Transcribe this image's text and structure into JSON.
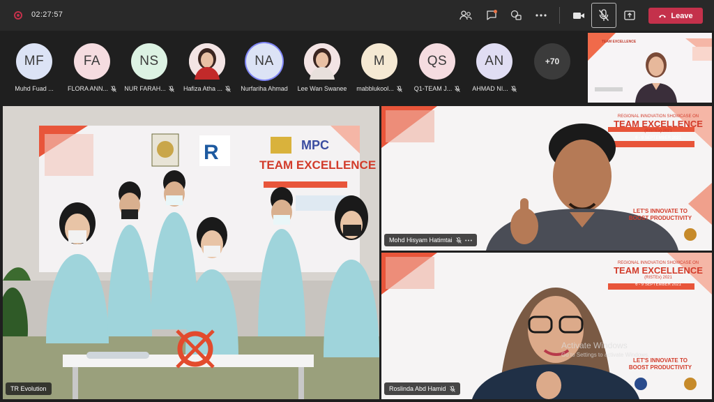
{
  "topbar": {
    "timer": "02:27:57",
    "leave_label": "Leave",
    "icons": [
      "record-icon",
      "participants-icon",
      "chat-icon",
      "reactions-icon",
      "more-options-icon",
      "camera-icon",
      "mic-off-icon",
      "share-icon",
      "phone-icon"
    ]
  },
  "participants": [
    {
      "initials": "MF",
      "name": "Muhd Fuad ...",
      "color": "#dce3f5",
      "muted": false
    },
    {
      "initials": "FA",
      "name": "FLORA ANN...",
      "color": "#f5dce0",
      "muted": true
    },
    {
      "initials": "NS",
      "name": "NUR FARAH...",
      "color": "#dcf2e3",
      "muted": true
    },
    {
      "initials": "",
      "name": "Hafiza Atha ...",
      "color": "#e7d9d9",
      "muted": true,
      "photo": true
    },
    {
      "initials": "NA",
      "name": "Nurfariha Ahmad",
      "color": "#dce3f5",
      "muted": false,
      "speaking": true
    },
    {
      "initials": "",
      "name": "Lee Wan Swanee",
      "color": "#e9d8cf",
      "muted": false,
      "photo": true
    },
    {
      "initials": "M",
      "name": "mabblukool...",
      "color": "#f5e9d3",
      "muted": true
    },
    {
      "initials": "QS",
      "name": "Q1-TEAM J...",
      "color": "#f5dce0",
      "muted": true
    },
    {
      "initials": "AN",
      "name": "AHMAD NI...",
      "color": "#e0ddf3",
      "muted": true
    }
  ],
  "more_count": "+70",
  "tiles": {
    "main": {
      "name": "TR Evolution"
    },
    "hisyam": {
      "name": "Mohd Hisyam Hatimtai"
    },
    "roslinda": {
      "name": "Roslinda Abd Hamid"
    }
  },
  "banner": {
    "line1": "REGIONAL INNOVATION SHOWCASE ON",
    "line2": "TEAM EXCELLENCE",
    "line3": "(RISTEx) 2021",
    "dates": "6 - 9 SEPTEMBER 2021",
    "slogan1": "LET'S INNOVATE TO",
    "slogan2": "BOOST PRODUCTIVITY",
    "mpc": "MPC"
  },
  "watermark": {
    "title": "Activate Windows",
    "sub": "Go to Settings to activate Windows."
  },
  "colors": {
    "leave": "#c4314b",
    "banner_red": "#e24b2d",
    "shirt": "#9fd4db"
  }
}
